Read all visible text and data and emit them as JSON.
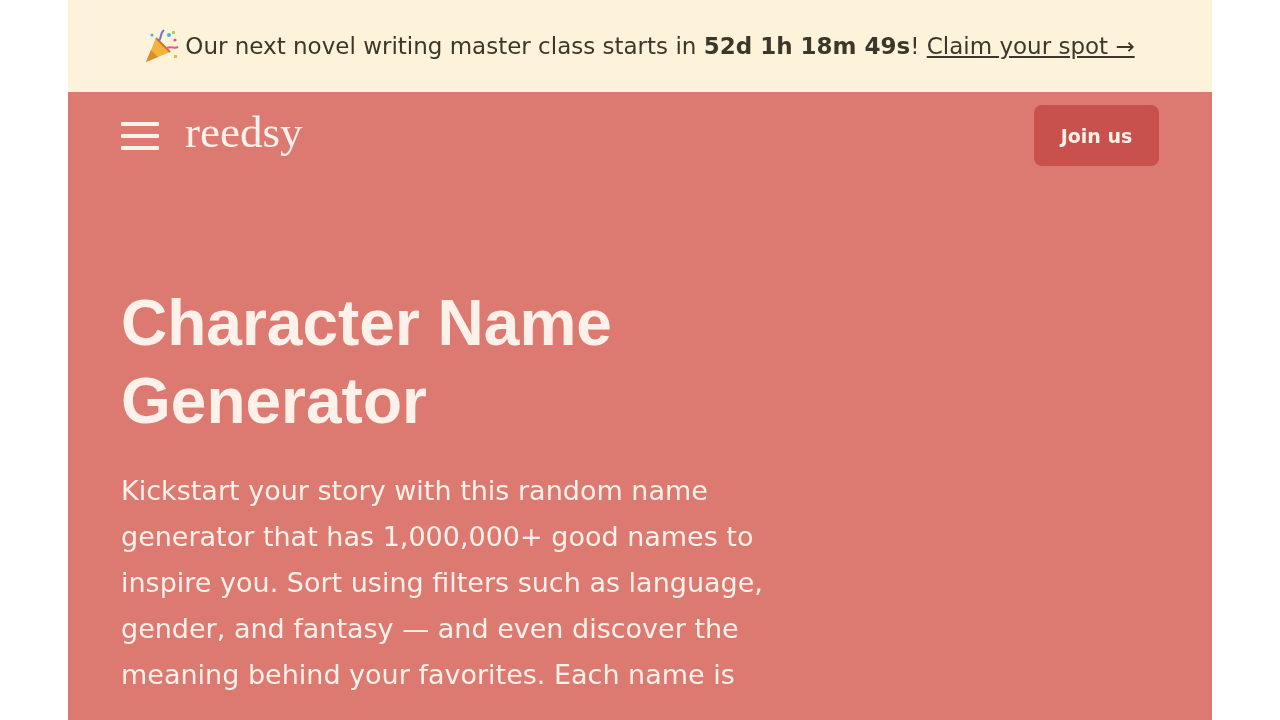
{
  "banner": {
    "text": "Our next novel writing master class starts in **52d 1h 18m 49s**!",
    "link": "Claim your spot →"
  },
  "header": {
    "logo": "reedsy",
    "button": "Join us"
  },
  "hero": {
    "title": "Character Name Generator",
    "description": "Kickstart your story with this random name generator that has 1,000,000+ good names to inspire you. Sort using filters such as language, gender, and fantasy — and even discover the meaning behind your favorites. Each name is"
  }
}
